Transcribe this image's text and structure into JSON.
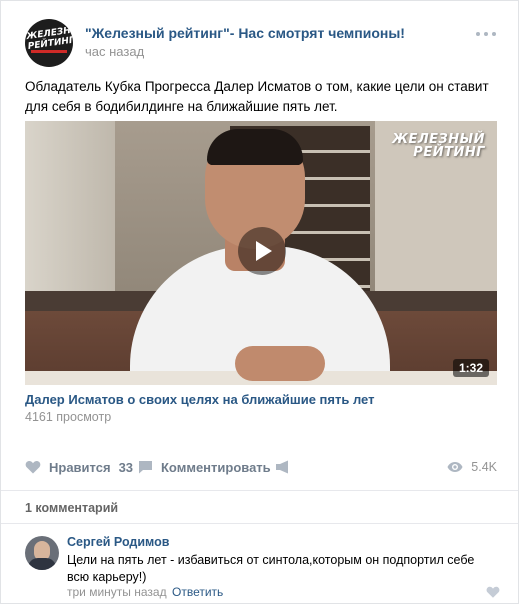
{
  "post": {
    "group_name": "\"Железный рейтинг\"- Нас смотрят чемпионы!",
    "time": "час назад",
    "avatar_logo_text": "ЖЕЛЕЗНЫЙ РЕЙТИНГ",
    "text": "Обладатель Кубка Прогресса Далер Исматов о том, какие цели он ставит для себя в бодибилдинге на ближайшие пять лет."
  },
  "video": {
    "brand_line1": "ЖЕЛЕЗНЫЙ",
    "brand_line2": "РЕЙТИНГ",
    "duration": "1:32",
    "title": "Далер Исматов о своих целях на ближайшие пять лет",
    "views": "4161 просмотр"
  },
  "actions": {
    "like_label": "Нравится",
    "like_count": "33",
    "comment_label": "Комментировать",
    "views_count": "5.4K"
  },
  "comments": {
    "count_label": "1 комментарий",
    "items": [
      {
        "author": "Сергей Родимов",
        "text": "Цели на пять лет - избавиться от синтола,которым он подпортил себе всю карьеру!)",
        "time": "три минуты назад",
        "reply_label": "Ответить"
      }
    ]
  },
  "colors": {
    "link": "#2a5885",
    "muted": "#939393",
    "action": "#6f7c8b",
    "icon": "#aeb7c2"
  }
}
